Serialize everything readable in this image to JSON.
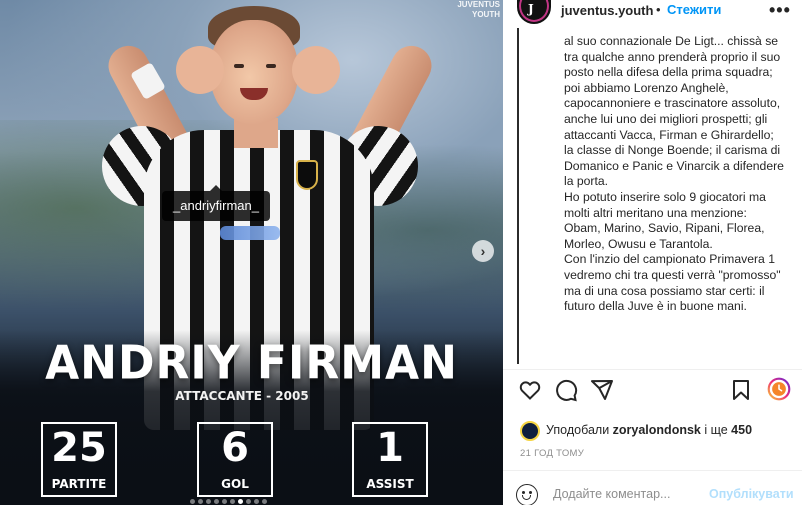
{
  "media": {
    "tagged_user": "_andriyfirman_",
    "corner_logo": "JUVENTUS YOUTH",
    "player_name": "ANDRIY FIRMAN",
    "player_role": "ATTACCANTE - 2005",
    "stats": [
      {
        "value": "25",
        "label": "PARTITE"
      },
      {
        "value": "6",
        "label": "GOL"
      },
      {
        "value": "1",
        "label": "ASSIST"
      }
    ],
    "carousel": {
      "total": 10,
      "active_index": 6
    },
    "next_icon": "chevron-right-icon"
  },
  "header": {
    "username": "juventus.youth",
    "separator": "•",
    "follow_label": "Стежити",
    "more_label": "•••",
    "avatar_mark": "J"
  },
  "caption": {
    "text": "al suo connazionale De Ligt... chissà se tra qualche anno prenderà proprio il suo posto nella difesa della prima squadra; poi abbiamo Lorenzo Anghelè, capocannoniere e trascinatore assoluto, anche lui uno dei migliori prospetti; gli attaccanti Vacca, Firman e Ghirardello; la classe di Nonge Boende; il carisma di Domanico e Panic e Vinarcik a difendere la porta.\nHo potuto inserire solo 9 giocatori ma molti altri meritano una menzione: Obam, Marino, Savio, Ripani, Florea, Morleo, Owusu e Tarantola.\nCon l'inzio del campionato Primavera 1 vedremo chi tra questi verrà \"promosso\" ma di una cosa possiamo star certi: il futuro della Juve è in buone mani."
  },
  "actions": {
    "icons": [
      "heart-icon",
      "comment-icon",
      "share-icon",
      "bookmark-icon",
      "story-icon"
    ]
  },
  "likes": {
    "prefix": "Уподобали ",
    "user": "zoryalondonsk",
    "middle": " і ще ",
    "count": "450"
  },
  "timestamp": "21 ГОД ТОМУ",
  "comment": {
    "placeholder": "Додайте коментар...",
    "publish_label": "Опублікувати"
  },
  "colors": {
    "accent": "#0095f6",
    "publish_disabled": "#b2dffc",
    "text": "#262626",
    "muted": "#8e8e8e"
  }
}
